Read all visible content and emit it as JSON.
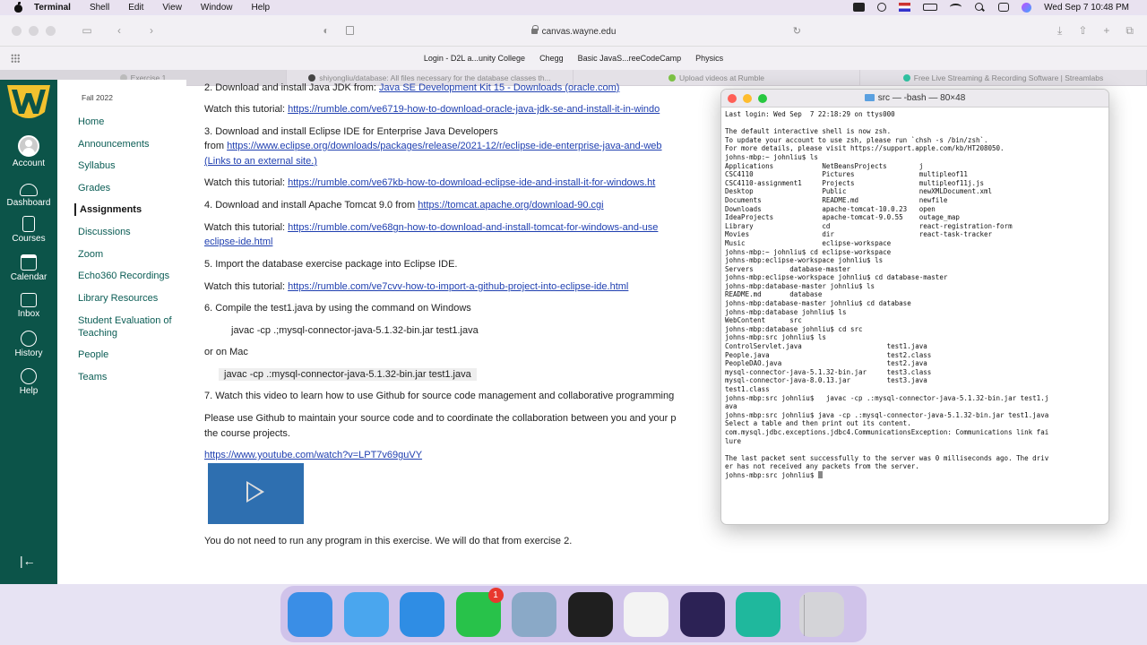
{
  "menubar": {
    "app": "Terminal",
    "items": [
      "Shell",
      "Edit",
      "View",
      "Window",
      "Help"
    ],
    "clock": "Wed Sep 7  10:48 PM"
  },
  "safari": {
    "url": "canvas.wayne.edu",
    "bookmarks": [
      "Login - D2L a...unity College",
      "Chegg",
      "Basic JavaS...reeCodeCamp",
      "Physics"
    ],
    "tabs": [
      "Exercise 1",
      "shiyongliu/database: All files necessary for the database classes th...",
      "Upload videos at Rumble",
      "Free Live Streaming & Recording Software | Streamlabs"
    ]
  },
  "global_nav": {
    "items": [
      {
        "label": "Account",
        "icon": "avatar-icon"
      },
      {
        "label": "Dashboard",
        "icon": "speedometer-icon"
      },
      {
        "label": "Courses",
        "icon": "book-icon"
      },
      {
        "label": "Calendar",
        "icon": "calendar-icon"
      },
      {
        "label": "Inbox",
        "icon": "inbox-icon"
      },
      {
        "label": "History",
        "icon": "clock-icon"
      },
      {
        "label": "Help",
        "icon": "question-icon"
      }
    ],
    "collapse_glyph": "|←"
  },
  "course_nav": {
    "term": "Fall 2022",
    "items": [
      "Home",
      "Announcements",
      "Syllabus",
      "Grades",
      "Assignments",
      "Discussions",
      "Zoom",
      "Echo360 Recordings",
      "Library Resources",
      "Student Evaluation of Teaching",
      "People",
      "Teams"
    ],
    "active": "Assignments"
  },
  "content": {
    "step2": "2. Download and install Java JDK from: ",
    "step2_link": "Java SE Development Kit 15 - Downloads (oracle.com)",
    "watch": "Watch this tutorial: ",
    "tut2": "https://rumble.com/ve6719-how-to-download-oracle-java-jdk-se-and-install-it-in-windo",
    "step3": "3. Download and install Eclipse IDE for Enterprise Java Developers",
    "from": "from ",
    "step3_link": "https://www.eclipse.org/downloads/packages/release/2021-12/r/eclipse-ide-enterprise-java-and-web",
    "ext_link": "(Links to an external site.)",
    "tut3": "https://rumble.com/ve67kb-how-to-download-eclipse-ide-and-install-it-for-windows.ht",
    "step4": "4. Download and install Apache Tomcat 9.0 from ",
    "step4_link": "https://tomcat.apache.org/download-90.cgi",
    "tut4": "https://rumble.com/ve68gn-how-to-download-and-install-tomcat-for-windows-and-use",
    "tut4b": "eclipse-ide.html",
    "step5": "5. Import the database exercise package into Eclipse IDE.",
    "tut5": "https://rumble.com/ve7cvv-how-to-import-a-github-project-into-eclipse-ide.html",
    "step6": "6. Compile the test1.java by using the command on Windows",
    "cmd_win": "javac -cp .;mysql-connector-java-5.1.32-bin.jar test1.java",
    "or_mac": "or  on Mac",
    "cmd_mac": "javac -cp .:mysql-connector-java-5.1.32-bin.jar test1.java",
    "step7": "7.  Watch this video to learn how to use Github for source code management and collaborative programming",
    "github1": "Please use Github to maintain your source code and to coordinate the collaboration between you and your p",
    "github2": "the course projects.",
    "youtube": "https://www.youtube.com/watch?v=LPT7v69guVY",
    "no_run": "You do not need to run any program in this exercise. We will do that from exercise 2."
  },
  "terminal": {
    "title": "src — -bash — 80×48",
    "lines": [
      "Last login: Wed Sep  7 22:18:29 on ttys000",
      "",
      "The default interactive shell is now zsh.",
      "To update your account to use zsh, please run `chsh -s /bin/zsh`.",
      "For more details, please visit https://support.apple.com/kb/HT208050.",
      "johns-mbp:~ johnliu$ ls",
      "Applications            NetBeansProjects        j",
      "CSC4110                 Pictures                multipleof11",
      "CSC4110-assignment1     Projects                multipleof11j.js",
      "Desktop                 Public                  newXMLDocument.xml",
      "Documents               README.md               newfile",
      "Downloads               apache-tomcat-10.0.23   open",
      "IdeaProjects            apache-tomcat-9.0.55    outage_map",
      "Library                 cd                      react-registration-form",
      "Movies                  dir                     react-task-tracker",
      "Music                   eclipse-workspace",
      "johns-mbp:~ johnliu$ cd eclipse-workspace",
      "johns-mbp:eclipse-workspace johnliu$ ls",
      "Servers         database-master",
      "johns-mbp:eclipse-workspace johnliu$ cd database-master",
      "johns-mbp:database-master johnliu$ ls",
      "README.md       database",
      "johns-mbp:database-master johnliu$ cd database",
      "johns-mbp:database johnliu$ ls",
      "WebContent      src",
      "johns-mbp:database johnliu$ cd src",
      "johns-mbp:src johnliu$ ls",
      "ControlServlet.java                     test1.java",
      "People.java                             test2.class",
      "PeopleDAO.java                          test2.java",
      "mysql-connector-java-5.1.32-bin.jar     test3.class",
      "mysql-connector-java-8.0.13.jar         test3.java",
      "test1.class",
      "johns-mbp:src johnliu$   javac -cp .:mysql-connector-java-5.1.32-bin.jar test1.j",
      "ava",
      "johns-mbp:src johnliu$ java -cp .:mysql-connector-java-5.1.32-bin.jar test1.java",
      "Select a table and then print out its content.",
      "com.mysql.jdbc.exceptions.jdbc4.CommunicationsException: Communications link fai",
      "lure",
      "",
      "The last packet sent successfully to the server was 0 milliseconds ago. The driv",
      "er has not received any packets from the server.",
      "johns-mbp:src johnliu$ "
    ]
  },
  "dock": {
    "apps": [
      {
        "name": "Finder",
        "color": "#3a8ee6"
      },
      {
        "name": "Mail",
        "color": "#4aa6ee"
      },
      {
        "name": "Safari",
        "color": "#2f8de4"
      },
      {
        "name": "WhatsApp",
        "color": "#28c24a",
        "badge": "1"
      },
      {
        "name": "Preview",
        "color": "#8aa9c7"
      },
      {
        "name": "Terminal",
        "color": "#1f1f1f"
      },
      {
        "name": "TextEdit",
        "color": "#f3f3f3"
      },
      {
        "name": "Eclipse",
        "color": "#2c2255"
      },
      {
        "name": "Streamlabs",
        "color": "#1fb89d"
      },
      {
        "name": "Trash",
        "color": "#d4d4d8"
      }
    ]
  }
}
